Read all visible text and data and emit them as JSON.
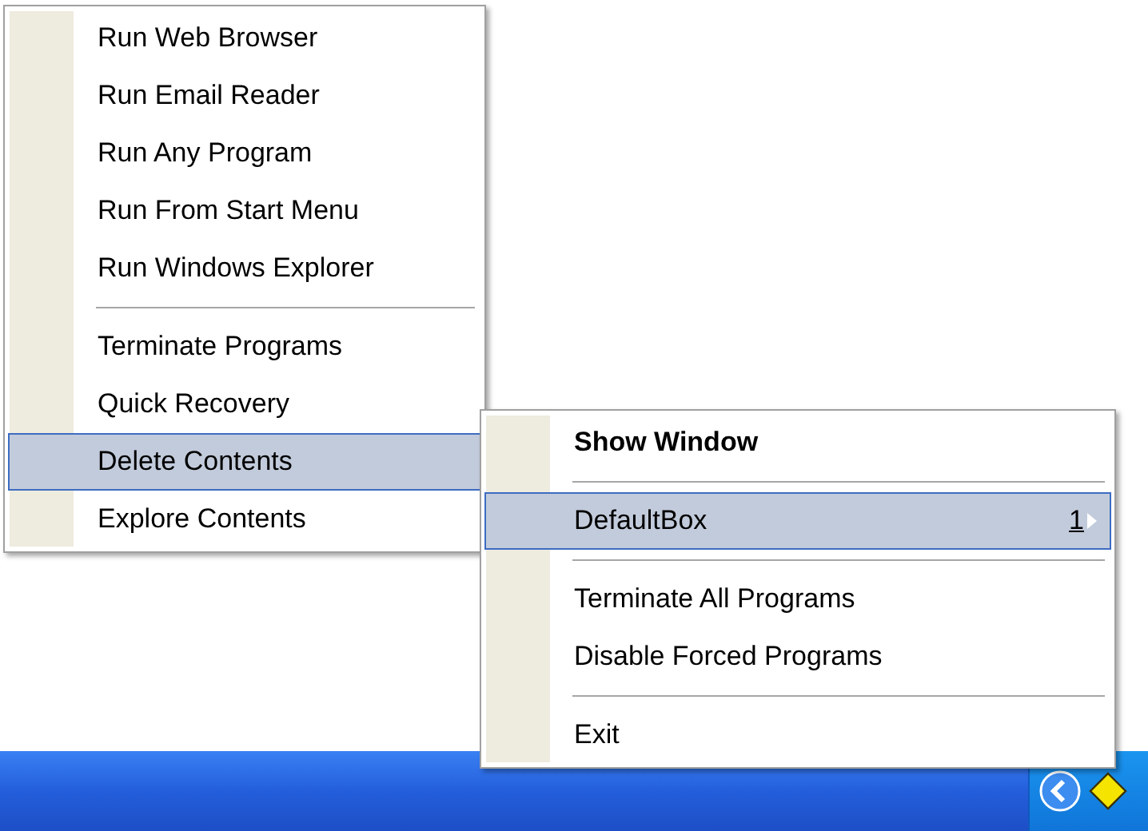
{
  "left_menu": {
    "items": [
      {
        "kind": "item",
        "label": "Run Web Browser",
        "selected": false
      },
      {
        "kind": "item",
        "label": "Run Email Reader",
        "selected": false
      },
      {
        "kind": "item",
        "label": "Run Any Program",
        "selected": false
      },
      {
        "kind": "item",
        "label": "Run From Start Menu",
        "selected": false
      },
      {
        "kind": "item",
        "label": "Run Windows Explorer",
        "selected": false
      },
      {
        "kind": "separator"
      },
      {
        "kind": "item",
        "label": "Terminate Programs",
        "selected": false
      },
      {
        "kind": "item",
        "label": "Quick Recovery",
        "selected": false
      },
      {
        "kind": "item",
        "label": "Delete Contents",
        "selected": true
      },
      {
        "kind": "item",
        "label": "Explore Contents",
        "selected": false
      }
    ]
  },
  "right_menu": {
    "items": [
      {
        "kind": "item",
        "label": "Show Window",
        "default": true,
        "selected": false
      },
      {
        "kind": "separator"
      },
      {
        "kind": "item",
        "label": "DefaultBox",
        "shortcut": "1",
        "submenu": true,
        "default": false,
        "selected": true
      },
      {
        "kind": "separator"
      },
      {
        "kind": "item",
        "label": "Terminate All Programs",
        "default": false,
        "selected": false
      },
      {
        "kind": "item",
        "label": "Disable Forced Programs",
        "default": false,
        "selected": false
      },
      {
        "kind": "separator"
      },
      {
        "kind": "item",
        "label": "Exit",
        "default": false,
        "selected": false
      }
    ]
  }
}
